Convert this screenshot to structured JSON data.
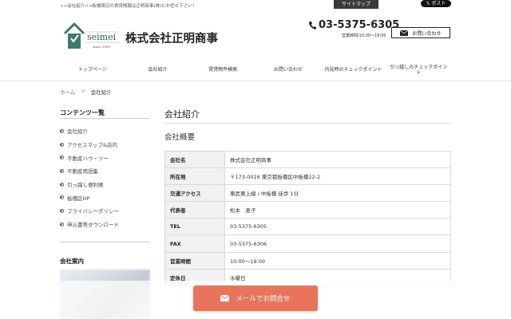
{
  "header": {
    "tagline": "<<会社紹介>>板橋周辺の賃貸情報は正明商事(株)にお任せ下さい！",
    "sitemap_label": "サイトマップ",
    "post_label": "𝕏 ポスト",
    "logo_text": "seimei",
    "logo_since": "since 1969",
    "company_name": "株式会社正明商事",
    "phone": "03-5375-6305",
    "hours": "営業時間/10:00〜19:00",
    "contact_label": "お問い合わせ"
  },
  "nav": {
    "items": [
      {
        "label": "トップページ"
      },
      {
        "label": "会社紹介"
      },
      {
        "label": "賃貸物件検索"
      },
      {
        "label": "お問い合わせ"
      },
      {
        "label": "内見時のチェックポイント"
      },
      {
        "label": "引っ越しのチェックポイント"
      }
    ]
  },
  "breadcrumb": {
    "home": "ホーム",
    "separator": ">",
    "current": "会社紹介"
  },
  "sidebar": {
    "title": "コンテンツ一覧",
    "items": [
      {
        "label": "会社紹介"
      },
      {
        "label": "アクセスマップ&店内"
      },
      {
        "label": "不動産ハウ・ツー"
      },
      {
        "label": "不動産用語集"
      },
      {
        "label": "引っ越し便利帳"
      },
      {
        "label": "板橋区HP"
      },
      {
        "label": "プライバシーポリシー"
      },
      {
        "label": "申込書等ダウンロード"
      }
    ],
    "title2": "会社案内"
  },
  "main": {
    "title": "会社紹介",
    "subtitle": "会社概要",
    "rows": [
      {
        "label": "会社名",
        "value": "株式会社正明商事"
      },
      {
        "label": "所在地",
        "value": "〒173-0016 東京都板橋区中板橋22-2"
      },
      {
        "label": "交通アクセス",
        "value": "東武東上線 / 中板橋 徒歩 1分"
      },
      {
        "label": "代表者",
        "value": "松本　恵子"
      },
      {
        "label": "TEL",
        "value": "03-5375-6305"
      },
      {
        "label": "FAX",
        "value": "03-5375-6306"
      },
      {
        "label": "営業時間",
        "value": "10:00〜19:00"
      },
      {
        "label": "定休日",
        "value": "水曜日"
      }
    ]
  },
  "floating": {
    "label": "メールでお問合せ"
  },
  "colors": {
    "accent": "#e8755b",
    "logo_green": "#3e7a6c",
    "link": "#4a7fb0"
  }
}
